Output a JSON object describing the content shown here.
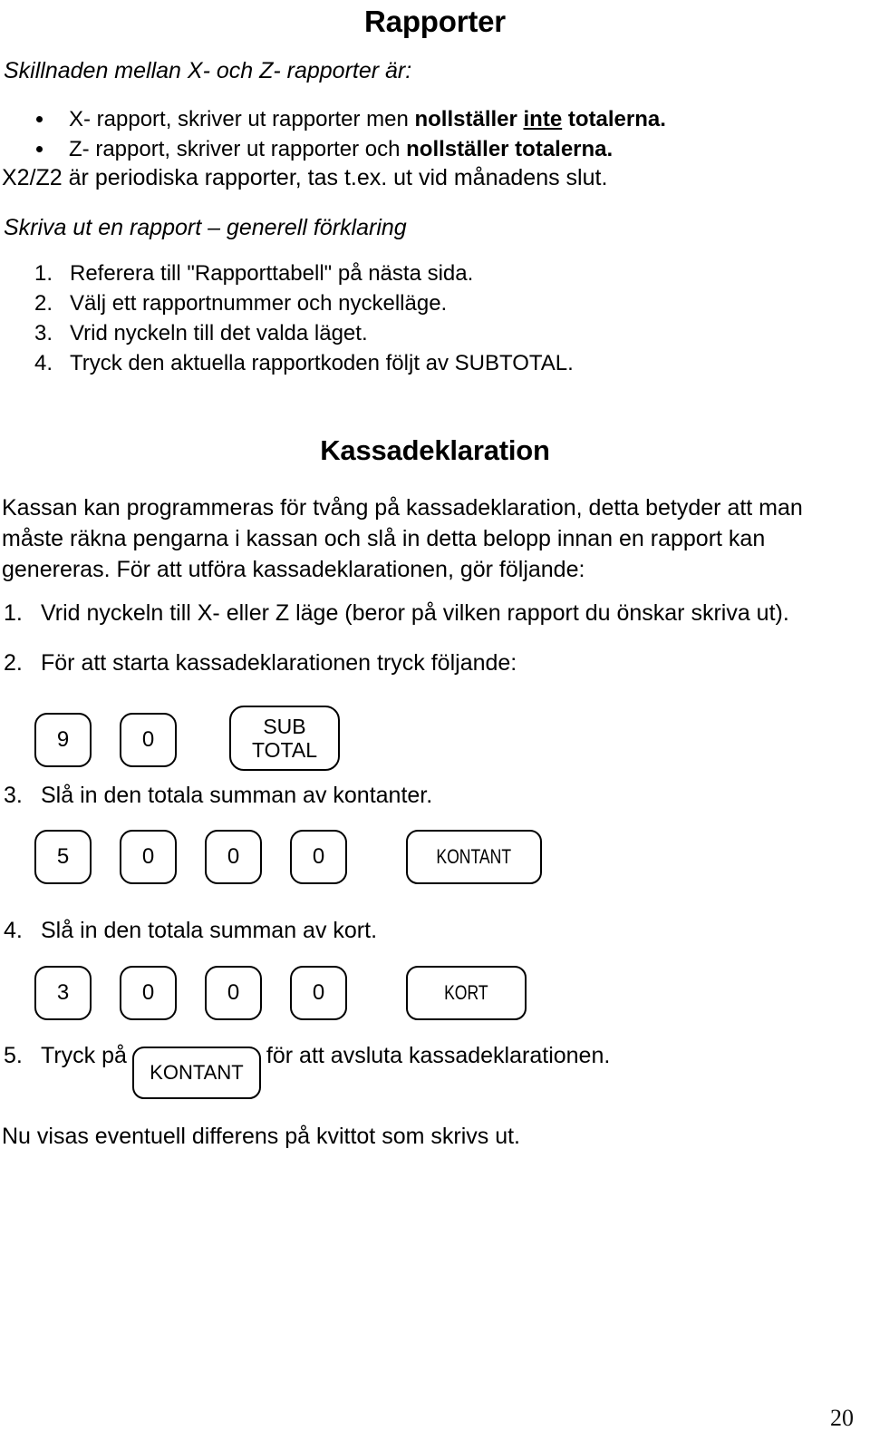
{
  "document": {
    "title": "Rapporter",
    "page_number": "20"
  },
  "reports_section": {
    "lead": "Skillnaden mellan X- och Z- rapporter är:",
    "bullets": [
      {
        "pre": "X- rapport, skriver ut rapporter men ",
        "bold_pre": "nollställer ",
        "bold_underline": "inte",
        "bold_post": " totalerna."
      },
      {
        "pre": "Z- rapport, skriver ut rapporter och ",
        "bold_pre": "nollställer totalerna.",
        "bold_underline": "",
        "bold_post": ""
      }
    ],
    "note": "X2/Z2 är periodiska rapporter, tas t.ex. ut vid månadens slut.",
    "subhead": "Skriva ut en rapport – generell förklaring",
    "steps": [
      {
        "num": "1.",
        "text": "Referera till \"Rapporttabell\" på nästa sida."
      },
      {
        "num": "2.",
        "text": "Välj ett rapportnummer och nyckelläge."
      },
      {
        "num": "3.",
        "text": "Vrid nyckeln till det valda läget."
      },
      {
        "num": "4.",
        "text": "Tryck den aktuella rapportkoden följt av SUBTOTAL."
      }
    ]
  },
  "cash_declaration": {
    "title": "Kassadeklaration",
    "intro_line_1": "Kassan kan programmeras för tvång på kassadeklaration, detta betyder att man",
    "intro_line_2": "måste räkna pengarna i kassan och slå in detta belopp innan en rapport kan",
    "intro_line_3": "genereras. För att utföra kassadeklarationen, gör följande:",
    "step1": {
      "num": "1.",
      "text": "Vrid nyckeln till X- eller Z läge (beror på vilken rapport du önskar skriva ut)."
    },
    "step2": {
      "num": "2.",
      "text": "För att starta kassadeklarationen tryck följande:"
    },
    "keys_row_1": [
      {
        "label": "9",
        "type": "digit"
      },
      {
        "label": "0",
        "type": "digit"
      },
      {
        "label_line1": "SUB",
        "label_line2": "TOTAL",
        "type": "subtotal"
      }
    ],
    "step3": {
      "num": "3.",
      "text": "Slå in den totala summan av kontanter."
    },
    "keys_row_2": [
      {
        "label": "5",
        "type": "digit"
      },
      {
        "label": "0",
        "type": "digit"
      },
      {
        "label": "0",
        "type": "digit"
      },
      {
        "label": "0",
        "type": "digit"
      },
      {
        "label": "KONTANT",
        "type": "function"
      }
    ],
    "step4": {
      "num": "4.",
      "text": "Slå in den totala summan av kort."
    },
    "keys_row_3": [
      {
        "label": "3",
        "type": "digit"
      },
      {
        "label": "0",
        "type": "digit"
      },
      {
        "label": "0",
        "type": "digit"
      },
      {
        "label": "0",
        "type": "digit"
      },
      {
        "label": "KORT",
        "type": "function"
      }
    ],
    "step5": {
      "num": "5.",
      "pre": "Tryck på",
      "key_label": "KONTANT",
      "post": "för att avsluta kassadeklarationen."
    },
    "closing": "Nu visas eventuell differens på kvittot som skrivs ut."
  }
}
